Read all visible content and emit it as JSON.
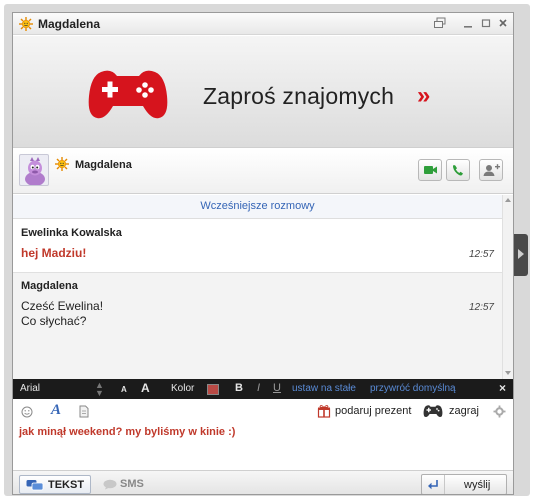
{
  "window": {
    "title": "Magdalena"
  },
  "banner": {
    "text": "Zaproś znajomych",
    "arrow": "»"
  },
  "contact": {
    "name": "Magdalena"
  },
  "chat": {
    "earlier_label": "Wcześniejsze rozmowy",
    "messages": [
      {
        "author": "Ewelinka Kowalska",
        "lines": [
          "hej Madziu!"
        ],
        "time": "12:57",
        "color": "#c0392b"
      },
      {
        "author": "Magdalena",
        "lines": [
          "Cześć Ewelina!",
          "Co słychać?"
        ],
        "time": "12:57",
        "color": "#222222"
      }
    ]
  },
  "format_bar": {
    "font": "Arial",
    "size_down": "A",
    "size_up": "A",
    "color_label": "Kolor",
    "color_value": "#b94a45",
    "bold": "B",
    "italic": "I",
    "underline": "U",
    "set_default": "ustaw na stałe",
    "restore_default": "przywróć domyślną",
    "close": "×"
  },
  "tools": {
    "gift": "podaruj prezent",
    "play": "zagraj"
  },
  "composer": {
    "text": "jak minął weekend? my byliśmy w kinie :)",
    "text_color": "#c0392b"
  },
  "bottom": {
    "tekst": "TEKST",
    "sms": "SMS",
    "send": "wyślij"
  },
  "colors": {
    "accent_red": "#d6141d",
    "link_blue": "#3565b6",
    "call_green": "#2e9e3a"
  }
}
